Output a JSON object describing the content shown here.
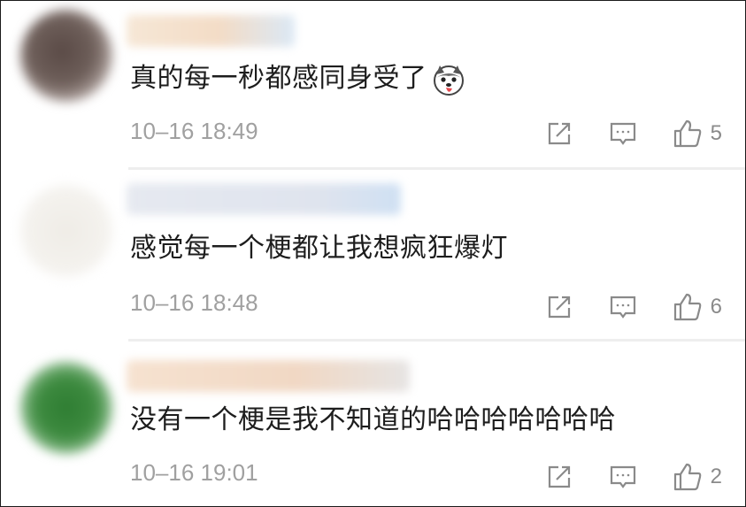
{
  "comments": [
    {
      "text": "真的每一秒都感同身受了",
      "emoji_icon": "husky-tongue-emoji-icon",
      "time": "10–16 18:49",
      "likes": "5"
    },
    {
      "text": "感觉每一个梗都让我想疯狂爆灯",
      "time": "10–16 18:48",
      "likes": "6"
    },
    {
      "text": "没有一个梗是我不知道的哈哈哈哈哈哈哈",
      "time": "10–16 19:01",
      "likes": "2"
    }
  ],
  "icons": {
    "share": "share-icon",
    "reply": "reply-comment-icon",
    "like": "thumbs-up-icon"
  },
  "colors": {
    "text": "#1d1d1d",
    "meta": "#a0a0a0",
    "icon": "#8a8a8a",
    "divider": "#eeeeee"
  }
}
